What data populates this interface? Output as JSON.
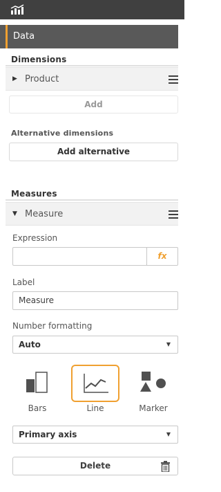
{
  "header": {
    "icon": "chart-combo-icon"
  },
  "panel": {
    "title": "Data"
  },
  "dimensions": {
    "title": "Dimensions",
    "item_label": "Product",
    "add_label": "Add",
    "alt_title": "Alternative dimensions",
    "add_alt_label": "Add alternative"
  },
  "measures": {
    "title": "Measures",
    "item_label": "Measure",
    "expression_label": "Expression",
    "expression_value": "",
    "fx_label": "fx",
    "label_label": "Label",
    "label_value": "Measure",
    "number_format_label": "Number formatting",
    "number_format_value": "Auto",
    "chart_types": [
      {
        "label": "Bars",
        "icon": "bars-icon",
        "selected": false
      },
      {
        "label": "Line",
        "icon": "line-icon",
        "selected": true
      },
      {
        "label": "Marker",
        "icon": "marker-icon",
        "selected": false
      }
    ],
    "axis_value": "Primary axis",
    "delete_label": "Delete"
  },
  "colors": {
    "accent": "#f0a030",
    "topbar": "#404040",
    "panel_header": "#595959"
  }
}
